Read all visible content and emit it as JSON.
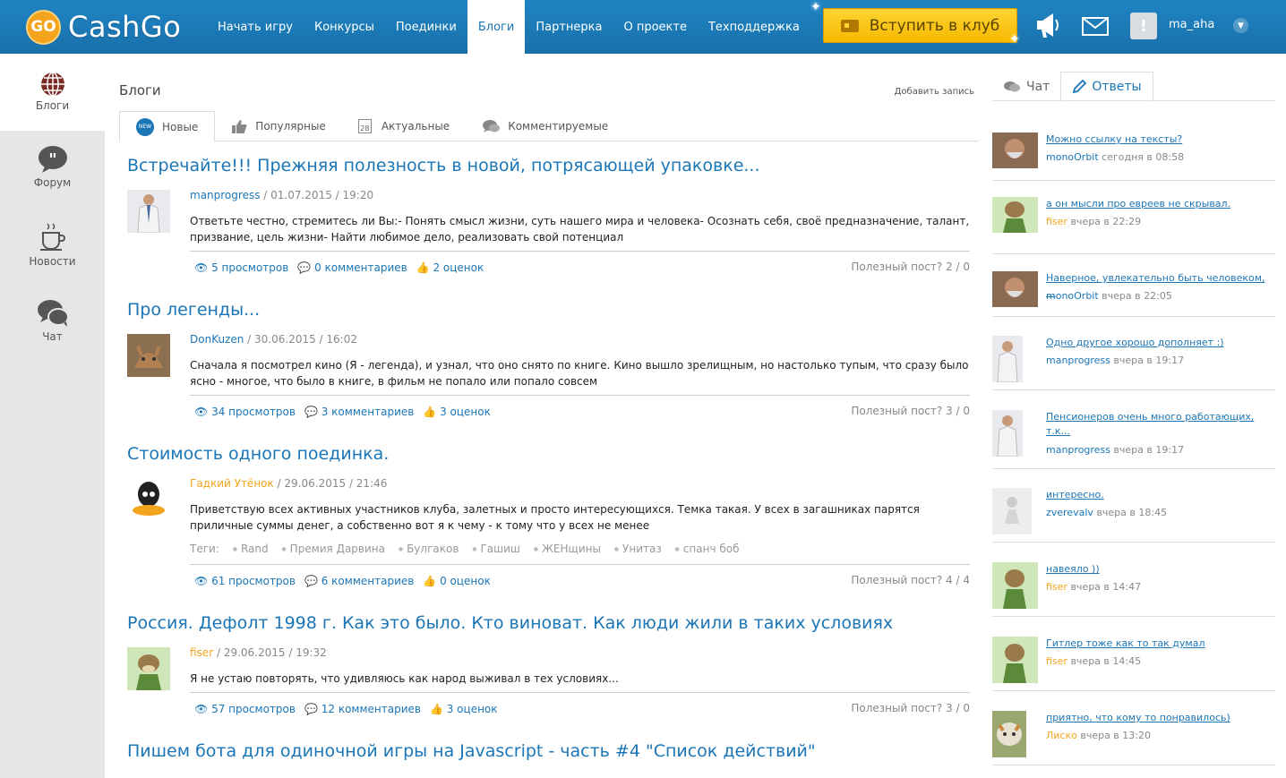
{
  "brand": {
    "logo_badge": "GO",
    "name": "CashGo"
  },
  "nav": [
    "Начать игру",
    "Конкурсы",
    "Поединки",
    "Блоги",
    "Партнерка",
    "О проекте",
    "Техподдержка"
  ],
  "join_button": "Вступить в клуб",
  "user": {
    "name": "ma_aha",
    "avatar_letter": "!"
  },
  "rail": [
    {
      "label": "Блоги",
      "icon": "globe-icon"
    },
    {
      "label": "Форум",
      "icon": "quote-bubble-icon"
    },
    {
      "label": "Новости",
      "icon": "coffee-cup-icon"
    },
    {
      "label": "Чат",
      "icon": "chat-bubbles-icon"
    }
  ],
  "blog": {
    "title": "Блоги",
    "add_post": "Добавить запись",
    "tabs": [
      "Новые",
      "Популярные",
      "Актуальные",
      "Комментируемые"
    ],
    "tab_badges": {
      "new": "NEW",
      "calendar": "28"
    }
  },
  "posts": [
    {
      "title": "Встречайте!!! Прежняя полезность в новой, потрясающей упаковке...",
      "author": "manprogress",
      "date": " / 01.07.2015 / 19:20",
      "text": "Ответьте честно, стремитесь ли Вы:- Понять смысл жизни, суть нашего мира и человека- Осознать себя, своё предназначение, талант, призвание, цель жизни- Найти любимое дело, реализовать свой потенциал",
      "views": "5 просмотров",
      "comments": "0 комментариев",
      "ratings": "2 оценок",
      "useful": "Полезный пост?  2 / 0"
    },
    {
      "title": "Про легенды...",
      "author": "DonKuzen",
      "date": " / 30.06.2015 / 16:02",
      "text": "Сначала я посмотрел кино (Я - легенда), и узнал, что оно снято по книге. Кино вышло зрелищным, но настолько тупым, что сразу было ясно - многое, что было в книге, в фильм не попало или попало совсем",
      "views": "34 просмотров",
      "comments": "3 комментариев",
      "ratings": "3 оценок",
      "useful": "Полезный пост?  3 / 0"
    },
    {
      "title": "Стоимость одного поединка.",
      "author": "Гадкий Утёнок",
      "date": " / 29.06.2015 / 21:46",
      "text": "Приветствую всех активных участников клуба, залетных и просто интересующихся. Темка такая.  У всех в загашниках парятся приличные суммы денег, а собственно вот я к чему - к тому что у всех не менее",
      "tags_label": "Теги:",
      "tags": [
        "Rand",
        "Премия Дарвина",
        "Булгаков",
        "Гашиш",
        "ЖЕНщины",
        "Унитаз",
        "спанч боб"
      ],
      "views": "61 просмотров",
      "comments": "6 комментариев",
      "ratings": "0 оценок",
      "useful": "Полезный пост?  4 / 4"
    },
    {
      "title": "Россия. Дефолт 1998 г. Как это было. Кто виноват. Как люди жили в таких условиях",
      "author": "fiser",
      "date": " / 29.06.2015 / 19:32",
      "text": "Я не устаю повторять, что удивляюсь как народ выживал в тех условиях...",
      "views": "57 просмотров",
      "comments": "12 комментариев",
      "ratings": "3 оценок",
      "useful": "Полезный пост?  3 / 0"
    },
    {
      "title": "Пишем бота для одиночной игры на Javascript - часть #4 \"Список действий\""
    }
  ],
  "sidebar": {
    "tabs": [
      "Чат",
      "Ответы"
    ],
    "answers": [
      {
        "text": "Можно ссылку на тексты?",
        "user": "monoOrbit",
        "time": " сегодня в 08:58",
        "avatar": "man-beard"
      },
      {
        "text": "а он мысли про евреев не скрывал.",
        "user": "fiser",
        "time": " вчера в 22:29",
        "avatar": "cow-cartoon"
      },
      {
        "text": "Наверное, увлекательно быть человеком, ...",
        "user": "monoOrbit",
        "time": " вчера в 22:05",
        "avatar": "man-beard"
      },
      {
        "text": "Одно другое хорошо дополняет :)",
        "user": "manprogress",
        "time": " вчера в 19:17",
        "avatar": "man-shirt"
      },
      {
        "text": "Пенсионеров очень много работающих, т.к...",
        "user": "manprogress",
        "time": " вчера в 19:17",
        "avatar": "man-shirt"
      },
      {
        "text": "интересно.",
        "user": "zverevalv",
        "time": " вчера в 18:45",
        "avatar": "grey-figure"
      },
      {
        "text": "навеяло ))",
        "user": "fiser",
        "time": " вчера в 14:47",
        "avatar": "cow-cartoon"
      },
      {
        "text": "Гитлер тоже как то так думал",
        "user": "fiser",
        "time": " вчера в 14:45",
        "avatar": "cow-cartoon"
      },
      {
        "text": "приятно, что кому то понравилось)",
        "user": "Лиско",
        "time": " вчера в 13:20",
        "avatar": "cat"
      }
    ]
  },
  "colors": {
    "header": "#1b76b7",
    "accent_orange": "#f3a41c",
    "join_button": "#f6c200",
    "link": "#1b76b7"
  }
}
